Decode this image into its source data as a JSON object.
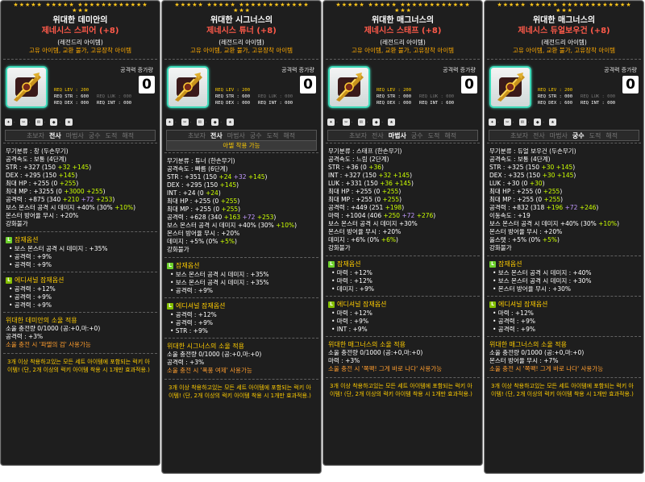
{
  "colors": {
    "panel": "#1e1e1e",
    "border": "#7a7a7a",
    "title_red": "#ff5a4a",
    "gold": "#ffcc00",
    "green": "#ccff00",
    "purple": "#c39bff",
    "icon_border": "#3ddab9"
  },
  "cards": [
    {
      "name": "위대한 데미안의",
      "subtitle": "제네시스 스피어 (+8)",
      "grade": "(레전드리 아이템)",
      "restrict": "고유 아이템, 교환 불가, 고유장착 아이템",
      "icon": "genesis-spear-icon",
      "atk_label": "공격력 증가량",
      "atk_value": "0",
      "req_lev": "REQ LEV : 200",
      "req_str": "REQ STR : 600",
      "req_luk": "REQ LUK : 000",
      "req_dex": "REQ DEX : 000",
      "req_int": "REQ INT : 000",
      "jobs": [
        "초보자",
        "전사",
        "마법사",
        "궁수",
        "도적",
        "해적"
      ],
      "active_job": 1,
      "job_note": "",
      "stats": [
        {
          "t": "무기분류 : 창 (두손무기)"
        },
        {
          "t": "공격속도 : 보통 (4단계)"
        },
        {
          "t": "STR : +327 (150 ",
          "a": "+32",
          "b": " +145",
          ")": ")"
        },
        {
          "t": "DEX : +295 (150 ",
          "b": "+145",
          ")": ")"
        },
        {
          "t": "최대 HP : +255 (0 ",
          "b": "+255",
          ")": ")"
        },
        {
          "t": "최대 MP : +3255 (0 ",
          "a": "+3000",
          "b": " +255",
          ")": ")"
        },
        {
          "t": "공격력 : +875 (340 ",
          "a": "+210",
          "c": " +72",
          "b": " +253",
          ")": ")"
        },
        {
          "t": "보스 몬스터 공격 시 데미지 +40% (30% ",
          "b": "+10%",
          ")": ")"
        },
        {
          "t": "몬스터 방어율 무시 : +20%"
        },
        {
          "t": "강화불가"
        }
      ],
      "potential_title": "잠재옵션",
      "potential": [
        "보스 몬스터 공격 시 데미지 : +35%",
        "공격력 : +9%",
        "공격력 : +9%"
      ],
      "additional_title": "에디셔널 잠재옵션",
      "additional": [
        "공격력 : +12%",
        "공격력 : +9%",
        "공격력 : +9%"
      ],
      "soul_title": "위대한 데미안의 소울 적용",
      "soul_charge": "소울 충전량 0/1000   (공:+0,마:+0)",
      "soul_stat": "공격력 : +3%",
      "soul_skill": "소울 충전 시 '파멸의 검' 사용가능",
      "set_note": "3개 이상 착용하고있는 모든 세트 아이템에 포함되는 럭키 아이템! (단, 2개 이상의 럭키 아이템 착용 시 1개만 효과적용.)"
    },
    {
      "name": "위대한 시그너스의",
      "subtitle": "제네시스 튜너 (+8)",
      "grade": "(레전드리 아이템)",
      "restrict": "고유 아이템, 교환 불가, 고유장착 아이템",
      "icon": "genesis-tuner-icon",
      "atk_label": "공격력 증가량",
      "atk_value": "0",
      "req_lev": "REQ LEV : 200",
      "req_str": "REQ STR : 600",
      "req_luk": "REQ LUK : 000",
      "req_dex": "REQ DEX : 000",
      "req_int": "REQ INT : 000",
      "jobs": [
        "초보자",
        "전사",
        "마법사",
        "궁수",
        "도적",
        "해적"
      ],
      "active_job": 1,
      "job_note": "아델 착용 가능",
      "stats": [
        {
          "t": "무기분류 : 튜너 (한손무기)"
        },
        {
          "t": "공격속도 : 빠름 (6단계)"
        },
        {
          "t": "STR : +351 (150 ",
          "a": "+24",
          "c": " +32",
          "b": " +145",
          ")": ")"
        },
        {
          "t": "DEX : +295 (150 ",
          "b": "+145",
          ")": ")"
        },
        {
          "t": "INT : +24 (0 ",
          "a": "+24",
          ")": ")"
        },
        {
          "t": "최대 HP : +255 (0 ",
          "b": "+255",
          ")": ")"
        },
        {
          "t": "최대 MP : +255 (0 ",
          "b": "+255",
          ")": ")"
        },
        {
          "t": "공격력 : +628 (340 ",
          "a": "+163",
          "c": " +72",
          "b": " +253",
          ")": ")"
        },
        {
          "t": "보스 몬스터 공격 시 데미지 +40% (30% ",
          "b": "+10%",
          ")": ")"
        },
        {
          "t": "몬스터 방어율 무시 : +20%"
        },
        {
          "t": "데미지 : +5% (0% ",
          "b": "+5%",
          ")": ")"
        },
        {
          "t": "강화불가"
        }
      ],
      "potential_title": "잠재옵션",
      "potential": [
        "보스 몬스터 공격 시 데미지 : +35%",
        "보스 몬스터 공격 시 데미지 : +35%",
        "공격력 : +9%"
      ],
      "additional_title": "에디셔널 잠재옵션",
      "additional": [
        "공격력 : +12%",
        "공격력 : +9%",
        "STR : +9%"
      ],
      "soul_title": "위대한 시그너스의 소울 적용",
      "soul_charge": "소울 충전량 0/1000   (공:+0,마:+0)",
      "soul_stat": "공격력 : +3%",
      "soul_skill": "소울 충전 시 '폭풍 여제' 사용가능",
      "set_note": "3개 이상 착용하고있는 모든 세트 아이템에 포함되는 럭키 아이템! (단, 2개 이상의 럭키 아이템 착용 시 1개만 효과적용.)"
    },
    {
      "name": "위대한 매그너스의",
      "subtitle": "제네시스 스태프 (+8)",
      "grade": "(레전드리 아이템)",
      "restrict": "고유 아이템, 교환 불가, 고유장착 아이템",
      "icon": "genesis-staff-icon",
      "atk_label": "공격력 증가량",
      "atk_value": "0",
      "req_lev": "REQ LEV : 200",
      "req_str": "REQ STR : 000",
      "req_luk": "REQ LUK : 000",
      "req_dex": "REQ DEX : 000",
      "req_int": "REQ INT : 600",
      "jobs": [
        "초보자",
        "전사",
        "마법사",
        "궁수",
        "도적",
        "해적"
      ],
      "active_job": 2,
      "job_note": "",
      "stats": [
        {
          "t": "무기분류 : 스태프 (한손무기)"
        },
        {
          "t": "공격속도 : 느림 (2단계)"
        },
        {
          "t": "STR : +36 (0 ",
          "a": "+36",
          ")": ")"
        },
        {
          "t": "INT : +327 (150 ",
          "a": "+32",
          "b": " +145",
          ")": ")"
        },
        {
          "t": "LUK : +331 (150 ",
          "a": "+36",
          "b": " +145",
          ")": ")"
        },
        {
          "t": "최대 HP : +255 (0 ",
          "b": "+255",
          ")": ")"
        },
        {
          "t": "최대 MP : +255 (0 ",
          "b": "+255",
          ")": ")"
        },
        {
          "t": "공격력 : +449 (251 ",
          "b": "+198",
          ")": ")"
        },
        {
          "t": "마력 : +1004 (406 ",
          "a": "+250",
          "c": " +72",
          "b": " +276",
          ")": ")"
        },
        {
          "t": "보스 몬스터 공격 시 데미지 +30%"
        },
        {
          "t": "몬스터 방어율 무시 : +20%"
        },
        {
          "t": "데미지 : +6% (0% ",
          "b": "+6%",
          ")": ")"
        },
        {
          "t": "강화불가"
        }
      ],
      "potential_title": "잠재옵션",
      "potential": [
        "마력 : +12%",
        "마력 : +12%",
        "데미지 : +9%"
      ],
      "additional_title": "에디셔널 잠재옵션",
      "additional": [
        "마력 : +12%",
        "마력 : +9%",
        "INT : +9%"
      ],
      "soul_title": "위대한 매그너스의 소울 적용",
      "soul_charge": "소울 충전량 0/1000   (공:+0,마:+0)",
      "soul_stat": "마력 : +3%",
      "soul_skill": "소울 충전 시 '쪽팩! 그게 바로 나다' 사용가능",
      "set_note": "3개 이상 착용하고있는 모든 세트 아이템에 포함되는 럭키 아이템! (단, 2개 이상의 럭키 아이템 착용 시 1개만 효과적용.)"
    },
    {
      "name": "위대한 매그너스의",
      "subtitle": "제네시스 듀얼보우건 (+8)",
      "grade": "(레전드리 아이템)",
      "restrict": "고유 아이템, 교환 불가, 고유장착 아이템",
      "icon": "genesis-dual-bowgun-icon",
      "atk_label": "공격력 증가량",
      "atk_value": "0",
      "req_lev": "REQ LEV : 200",
      "req_str": "REQ STR : 000",
      "req_luk": "REQ LUK : 000",
      "req_dex": "REQ DEX : 600",
      "req_int": "REQ INT : 000",
      "jobs": [
        "초보자",
        "전사",
        "마법사",
        "궁수",
        "도적",
        "해적"
      ],
      "active_job": 3,
      "job_note": "",
      "stats": [
        {
          "t": "무기분류 : 듀얼 보우건 (두손무기)"
        },
        {
          "t": "공격속도 : 보통 (4단계)"
        },
        {
          "t": "STR : +325 (150 ",
          "a": "+30",
          "b": " +145",
          ")": ")"
        },
        {
          "t": "DEX : +325 (150 ",
          "a": "+30",
          "b": " +145",
          ")": ")"
        },
        {
          "t": "LUK : +30 (0 ",
          "a": "+30",
          ")": ")"
        },
        {
          "t": "최대 HP : +255 (0 ",
          "b": "+255",
          ")": ")"
        },
        {
          "t": "최대 MP : +255 (0 ",
          "b": "+255",
          ")": ")"
        },
        {
          "t": "공격력 : +832 (318 ",
          "a": "+196",
          "c": " +72",
          "b": " +246",
          ")": ")"
        },
        {
          "t": "이동속도 : +19"
        },
        {
          "t": "보스 몬스터 공격 시 데미지 +40% (30% ",
          "b": "+10%",
          ")": ")"
        },
        {
          "t": "몬스터 방어율 무시 : +20%"
        },
        {
          "t": "올스탯 : +5% (0% ",
          "b": "+5%",
          ")": ")"
        },
        {
          "t": "강화불가"
        }
      ],
      "potential_title": "잠재옵션",
      "potential": [
        "보스 몬스터 공격 시 데미지 : +40%",
        "보스 몬스터 공격 시 데미지 : +30%",
        "몬스터 방어율 무시 : +30%"
      ],
      "additional_title": "에디셔널 잠재옵션",
      "additional": [
        "마력 : +12%",
        "공격력 : +9%",
        "공격력 : +9%"
      ],
      "soul_title": "위대한 매그너스의 소울 적용",
      "soul_charge": "소울 충전량 0/1000   (공:+0,마:+0)",
      "soul_stat": "몬스터 방어율 무시 : +7%",
      "soul_skill": "소울 충전 시 '쪽팩! 그게 바로 나다' 사용가능",
      "set_note": "3개 이상 착용하고있는 모든 세트 아이템에 포함되는 럭키 아이템! (단, 2개 이상의 럭키 아이템 착용 시 1개만 효과적용.)"
    }
  ]
}
